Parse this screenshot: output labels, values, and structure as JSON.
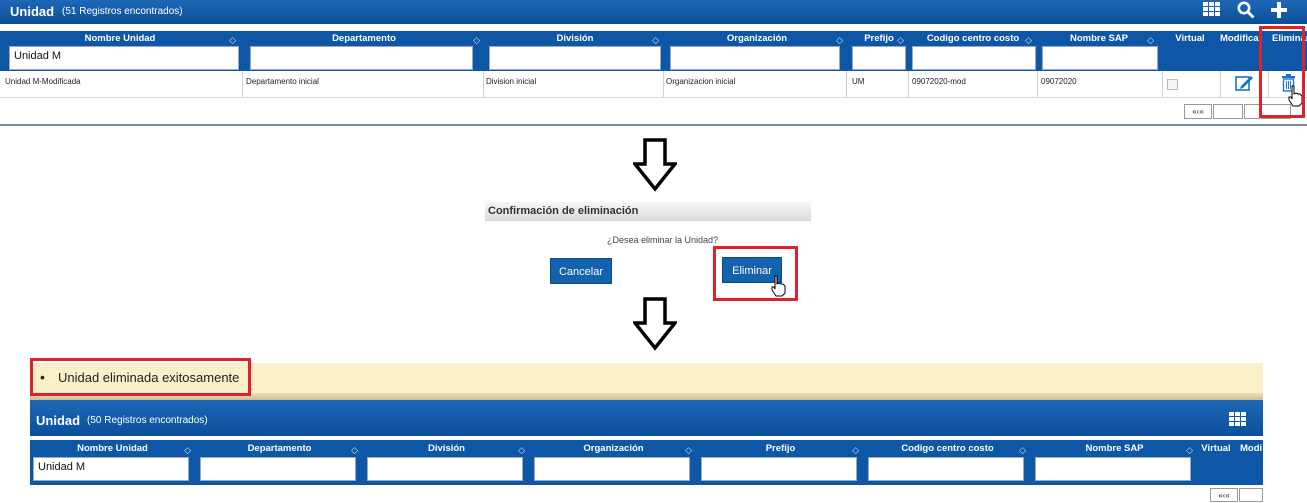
{
  "panel1": {
    "title": "Unidad",
    "count": "(51 Registros encontrados)",
    "columns": [
      "Nombre Unidad",
      "Departamento",
      "División",
      "Organización",
      "Prefijo",
      "Codigo centro costo",
      "Nombre SAP",
      "Virtual",
      "Modificar",
      "Eliminar"
    ],
    "filter_value": "Unidad M",
    "row": [
      "Unidad M-Modificada",
      "Departamento inicial",
      "Division inicial",
      "Organizacion inicial",
      "UM",
      "09072020-mod",
      "09072020"
    ],
    "pager_first": "«‹«"
  },
  "dialog": {
    "title": "Confirmación de eliminación",
    "message": "¿Desea eliminar la Unidad?",
    "cancel": "Cancelar",
    "confirm": "Eliminar"
  },
  "notice": {
    "message": "Unidad eliminada exitosamente"
  },
  "panel2": {
    "title": "Unidad",
    "count": "(50 Registros encontrados)",
    "columns": [
      "Nombre Unidad",
      "Departamento",
      "División",
      "Organización",
      "Prefijo",
      "Codigo centro costo",
      "Nombre SAP",
      "Virtual",
      "Modi"
    ],
    "filter_value": "Unidad M",
    "pager_first": "«‹«"
  },
  "colors": {
    "header_blue": "#0d57a6",
    "highlight_red": "#e0202a",
    "notice_bg": "#faf0c8"
  },
  "icons": [
    "grid-icon",
    "search-icon",
    "plus-icon",
    "edit-icon",
    "trash-icon",
    "hand-cursor-icon",
    "down-arrow-icon"
  ]
}
